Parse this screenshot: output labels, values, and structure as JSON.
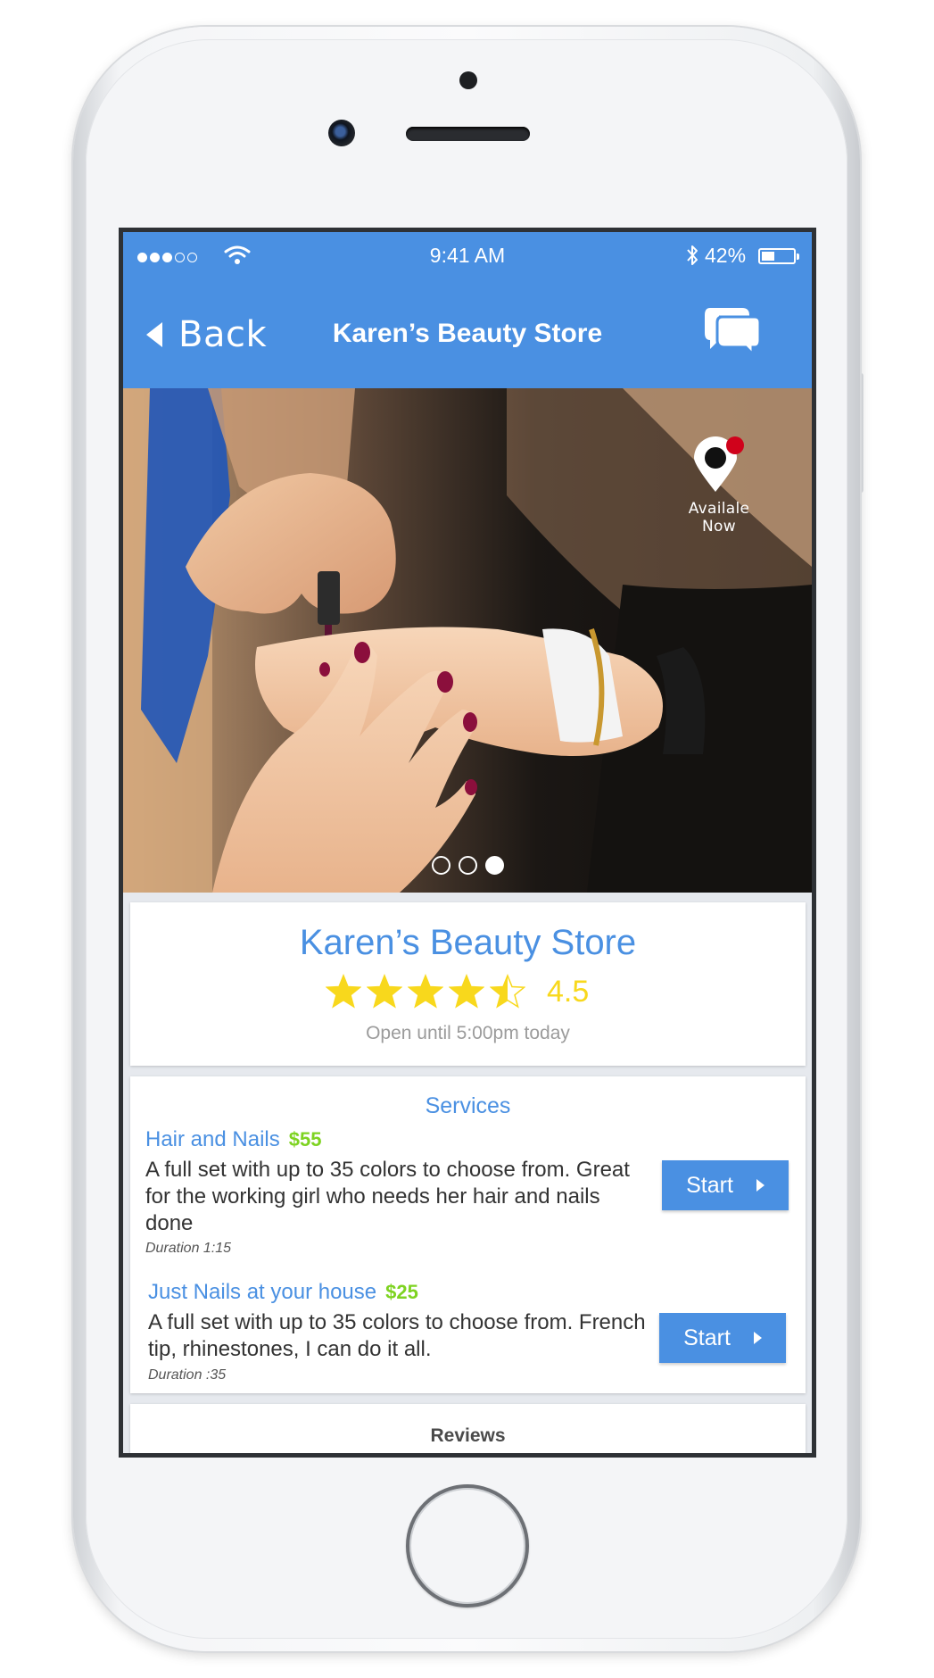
{
  "status_bar": {
    "time": "9:41 AM",
    "battery_percent": "42%",
    "battery_level": 0.42,
    "signal_bars_filled": 3,
    "signal_bars_total": 5
  },
  "nav": {
    "back_label": "Back",
    "title": "Karen’s Beauty Store",
    "chat_icon": "chat-bubbles-icon"
  },
  "hero": {
    "availability_label": "Availale Now",
    "pin_icon": "location-pin-icon",
    "slide_count": 3,
    "active_slide": 3
  },
  "store": {
    "name": "Karen’s Beauty Store",
    "rating": "4.5",
    "rating_value": 4.5,
    "hours": "Open until 5:00pm today"
  },
  "services": {
    "title": "Services",
    "items": [
      {
        "name": "Hair and Nails",
        "price": "$55",
        "description": "A full set with up to 35 colors to choose from. Great for the working girl who needs her hair and nails done",
        "duration": "Duration 1:15",
        "button_label": "Start"
      },
      {
        "name": "Just Nails at your house",
        "price": "$25",
        "description": "A full set with up to 35 colors to choose from. French tip, rhinestones, I can do it all.",
        "duration": "Duration :35",
        "button_label": "Start"
      }
    ]
  },
  "reviews": {
    "title": "Reviews"
  },
  "colors": {
    "brand_blue": "#4a90e2",
    "star_yellow": "#f8d81c",
    "price_green": "#7ed321",
    "notification_red": "#d0021b"
  }
}
